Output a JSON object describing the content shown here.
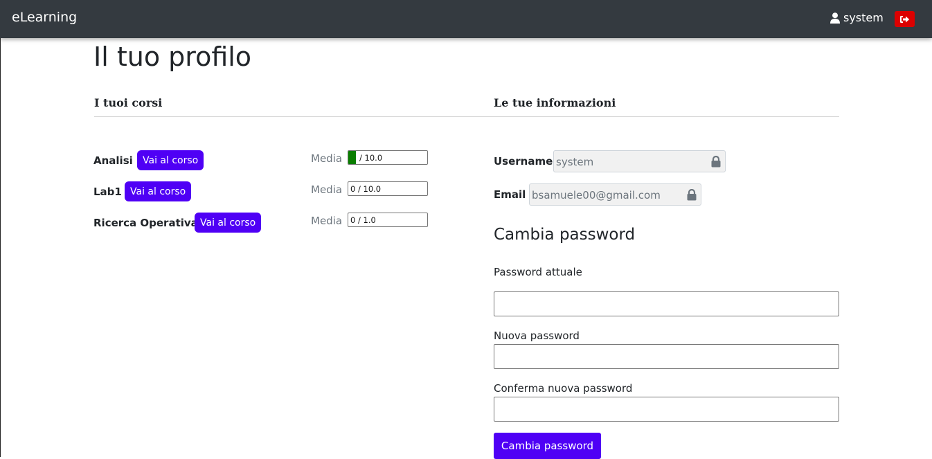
{
  "navbar": {
    "brand": "eLearning",
    "username": "system",
    "user_icon": "user-icon",
    "logout_icon": "sign-out-icon",
    "logout_color": "#dc0000"
  },
  "page": {
    "title": "Il tuo profilo"
  },
  "courses": {
    "heading": "I tuoi corsi",
    "button_label": "Vai al corso",
    "media_label": "Media",
    "items": [
      {
        "name": "Analisi",
        "grade": "1",
        "max": "10.0",
        "grade_fraction": 0.1,
        "grade_text": "/ 10.0"
      },
      {
        "name": "Lab1",
        "grade": "0",
        "max": "10.0",
        "grade_fraction": 0,
        "grade_text": "0 / 10.0"
      },
      {
        "name": "Ricerca Operativa",
        "grade": "0",
        "max": "1.0",
        "grade_fraction": 0,
        "grade_text": "0 / 1.0"
      }
    ]
  },
  "info": {
    "heading": "Le tue informazioni",
    "username_label": "Username",
    "username_value": "system",
    "email_label": "Email",
    "email_value": "bsamuele00@gmail.com",
    "lock_icon": "lock-icon"
  },
  "password": {
    "title": "Cambia password",
    "current_label": "Password attuale",
    "new_label": "Nuova password",
    "confirm_label": "Conferma nuova password",
    "submit_label": "Cambia password"
  },
  "colors": {
    "navbar_bg": "#343a40",
    "accent": "#4f00f5",
    "grade_fill": "#0a7d00"
  }
}
